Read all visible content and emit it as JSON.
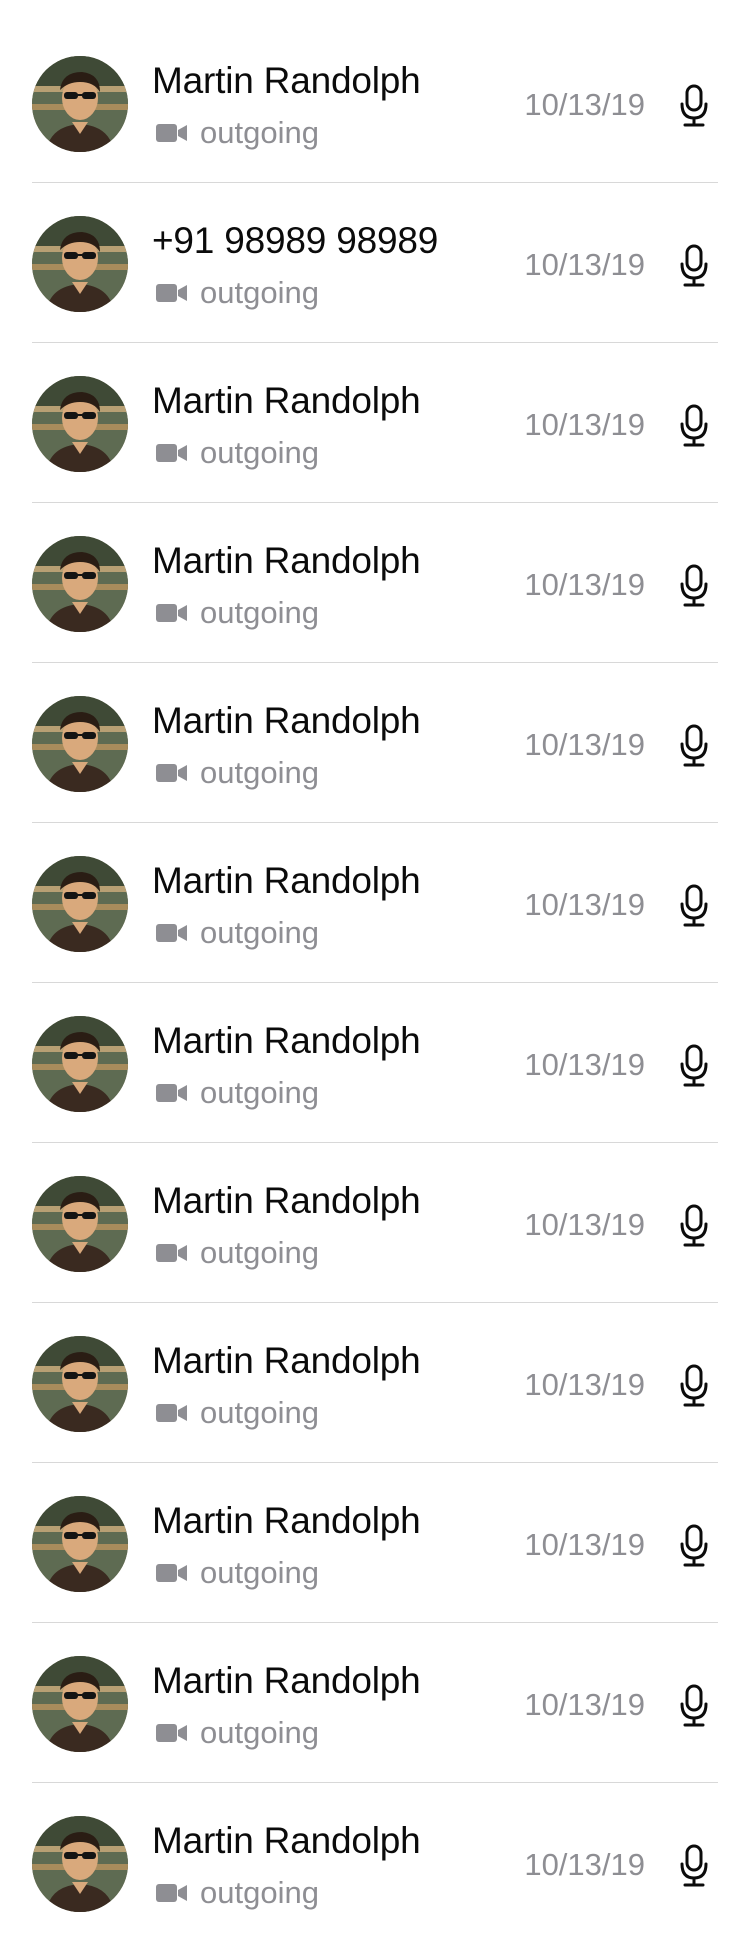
{
  "calls": [
    {
      "name": "Martin Randolph",
      "call_type": "outgoing",
      "date": "10/13/19",
      "avatar_icon": "person-photo",
      "type_icon": "video-camera-icon",
      "action_icon": "microphone-icon"
    },
    {
      "name": "+91 98989 98989",
      "call_type": "outgoing",
      "date": "10/13/19",
      "avatar_icon": "person-photo",
      "type_icon": "video-camera-icon",
      "action_icon": "microphone-icon"
    },
    {
      "name": "Martin Randolph",
      "call_type": "outgoing",
      "date": "10/13/19",
      "avatar_icon": "person-photo",
      "type_icon": "video-camera-icon",
      "action_icon": "microphone-icon"
    },
    {
      "name": "Martin Randolph",
      "call_type": "outgoing",
      "date": "10/13/19",
      "avatar_icon": "person-photo",
      "type_icon": "video-camera-icon",
      "action_icon": "microphone-icon"
    },
    {
      "name": "Martin Randolph",
      "call_type": "outgoing",
      "date": "10/13/19",
      "avatar_icon": "person-photo",
      "type_icon": "video-camera-icon",
      "action_icon": "microphone-icon"
    },
    {
      "name": "Martin Randolph",
      "call_type": "outgoing",
      "date": "10/13/19",
      "avatar_icon": "person-photo",
      "type_icon": "video-camera-icon",
      "action_icon": "microphone-icon"
    },
    {
      "name": "Martin Randolph",
      "call_type": "outgoing",
      "date": "10/13/19",
      "avatar_icon": "person-photo",
      "type_icon": "video-camera-icon",
      "action_icon": "microphone-icon"
    },
    {
      "name": "Martin Randolph",
      "call_type": "outgoing",
      "date": "10/13/19",
      "avatar_icon": "person-photo",
      "type_icon": "video-camera-icon",
      "action_icon": "microphone-icon"
    },
    {
      "name": "Martin Randolph",
      "call_type": "outgoing",
      "date": "10/13/19",
      "avatar_icon": "person-photo",
      "type_icon": "video-camera-icon",
      "action_icon": "microphone-icon"
    },
    {
      "name": "Martin Randolph",
      "call_type": "outgoing",
      "date": "10/13/19",
      "avatar_icon": "person-photo",
      "type_icon": "video-camera-icon",
      "action_icon": "microphone-icon"
    },
    {
      "name": "Martin Randolph",
      "call_type": "outgoing",
      "date": "10/13/19",
      "avatar_icon": "person-photo",
      "type_icon": "video-camera-icon",
      "action_icon": "microphone-icon"
    },
    {
      "name": "Martin Randolph",
      "call_type": "outgoing",
      "date": "10/13/19",
      "avatar_icon": "person-photo",
      "type_icon": "video-camera-icon",
      "action_icon": "microphone-icon"
    }
  ],
  "colors": {
    "name_text": "#0b0b0b",
    "secondary_text": "#8e8e93",
    "divider": "#d8d8d8",
    "background": "#ffffff"
  }
}
